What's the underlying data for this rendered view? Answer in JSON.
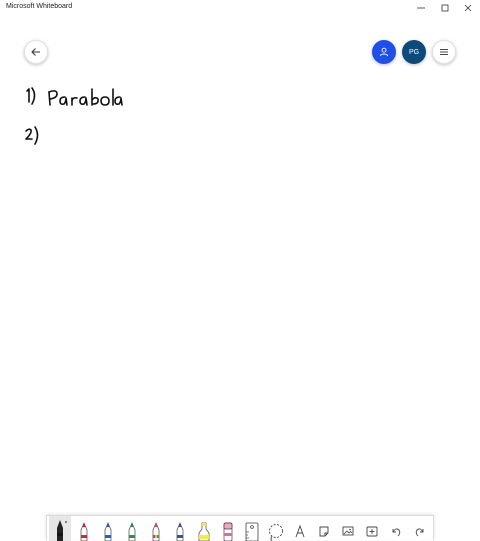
{
  "window": {
    "title": "Microsoft Whiteboard"
  },
  "header": {
    "back_icon": "arrow-left-icon",
    "share_icon": "person-icon",
    "avatar_initials": "PG",
    "menu_icon": "hamburger-icon"
  },
  "board": {
    "ink_lines": [
      "1) Parabola",
      "2)"
    ]
  },
  "toolbar": {
    "tools": [
      "black-pen",
      "red-pen",
      "blue-pen",
      "green-pen",
      "rainbow-pen",
      "galaxy-pen",
      "highlighter",
      "eraser",
      "ruler",
      "lasso",
      "text",
      "sticky-note",
      "image",
      "add",
      "undo",
      "redo"
    ],
    "active_tool": "black-pen"
  }
}
